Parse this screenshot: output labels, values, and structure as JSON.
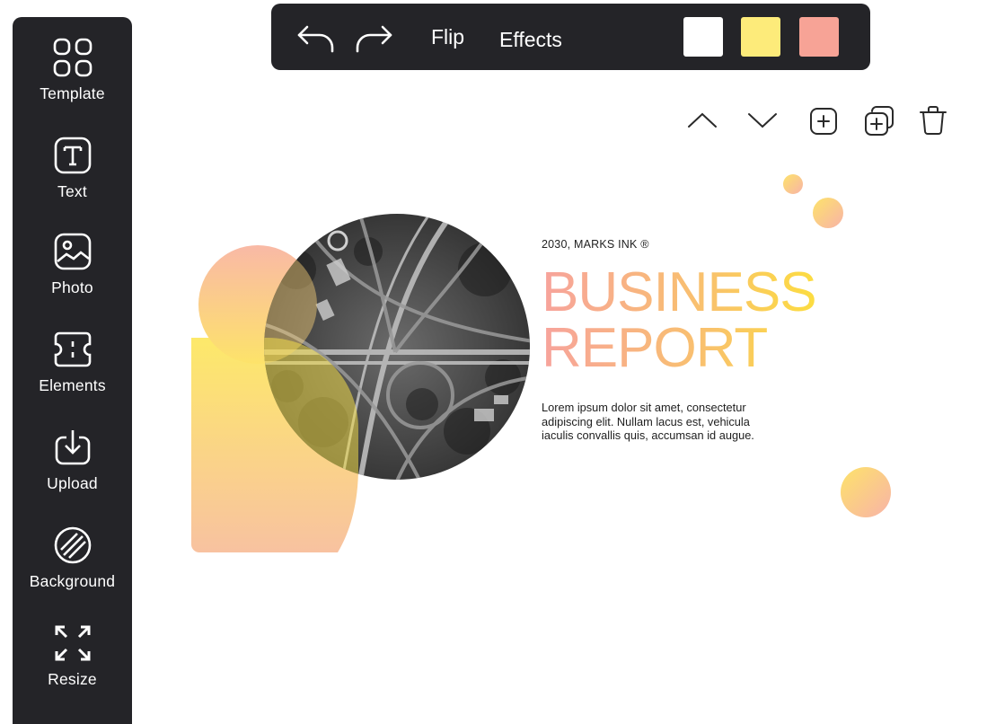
{
  "sidebar": {
    "items": [
      {
        "label": "Template",
        "icon": "grid-icon"
      },
      {
        "label": "Text",
        "icon": "text-icon"
      },
      {
        "label": "Photo",
        "icon": "photo-icon"
      },
      {
        "label": "Elements",
        "icon": "elements-icon"
      },
      {
        "label": "Upload",
        "icon": "upload-icon"
      },
      {
        "label": "Background",
        "icon": "background-icon"
      },
      {
        "label": "Resize",
        "icon": "resize-icon"
      }
    ]
  },
  "toolbar": {
    "undo_icon": "undo-icon",
    "redo_icon": "redo-icon",
    "flip_label": "Flip",
    "effects_label": "Effects",
    "swatches": [
      "#ffffff",
      "#fdeb7a",
      "#f7a396"
    ]
  },
  "actions": {
    "icons": [
      "chevron-up-icon",
      "chevron-down-icon",
      "add-page-icon",
      "duplicate-icon",
      "trash-icon"
    ]
  },
  "design": {
    "meta": "2030, MARKS INK ®",
    "headline_line1": "BUSINESS",
    "headline_line2": "REPORT",
    "body": "Lorem ipsum dolor sit amet, consectetur adipiscing elit. Nullam lacus est, vehicula iaculis convallis quis, accumsan id augue.",
    "colors": {
      "gradient_start": "#f7a39c",
      "gradient_end": "#fde03b"
    }
  }
}
